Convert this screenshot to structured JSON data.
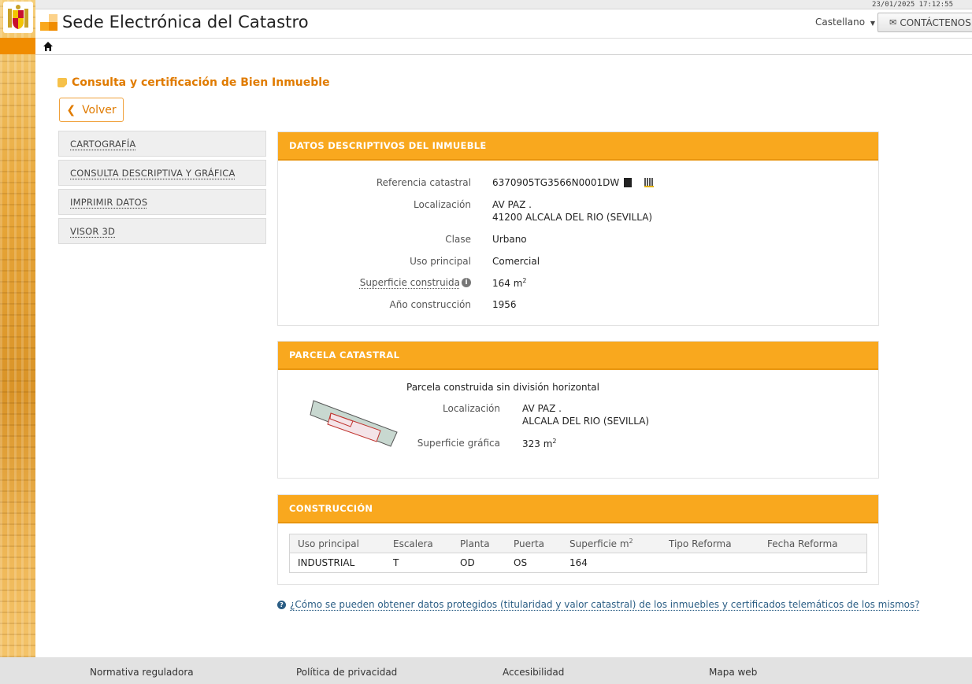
{
  "timestamp": "23/01/2025  17:12:55",
  "header": {
    "site_title": "Sede Electrónica del Catastro",
    "language": "Castellano",
    "contact_label": "CONTÁCTENOS"
  },
  "page": {
    "title": "Consulta y certificación de Bien Inmueble",
    "back_label": "Volver"
  },
  "sidemenu": {
    "items": [
      {
        "label": "CARTOGRAFÍA"
      },
      {
        "label": "CONSULTA DESCRIPTIVA Y GRÁFICA"
      },
      {
        "label": "IMPRIMIR DATOS"
      },
      {
        "label": "VISOR 3D"
      }
    ]
  },
  "datos": {
    "heading": "DATOS DESCRIPTIVOS DEL INMUEBLE",
    "ref_label": "Referencia catastral",
    "ref_value": "6370905TG3566N0001DW",
    "loc_label": "Localización",
    "loc_line1": "AV PAZ .",
    "loc_line2": "41200 ALCALA DEL RIO (SEVILLA)",
    "clase_label": "Clase",
    "clase_value": "Urbano",
    "uso_label": "Uso principal",
    "uso_value": "Comercial",
    "sup_label": "Superficie construida",
    "sup_value": "164 m",
    "sup_unit_exp": "2",
    "anio_label": "Año construcción",
    "anio_value": "1956"
  },
  "parcela": {
    "heading": "PARCELA CATASTRAL",
    "tipo": "Parcela construida sin división horizontal",
    "loc_label": "Localización",
    "loc_line1": "AV PAZ .",
    "loc_line2": "ALCALA DEL RIO (SEVILLA)",
    "sup_label": "Superficie gráfica",
    "sup_value": "323 m",
    "sup_unit_exp": "2"
  },
  "construccion": {
    "heading": "CONSTRUCCIÓN",
    "columns": [
      "Uso principal",
      "Escalera",
      "Planta",
      "Puerta",
      "Superficie m",
      "Tipo Reforma",
      "Fecha Reforma"
    ],
    "sup_col_exp": "2",
    "rows": [
      [
        "INDUSTRIAL",
        "T",
        "OD",
        "OS",
        "164",
        "",
        ""
      ]
    ]
  },
  "info_link": "¿Cómo se pueden obtener datos protegidos (titularidad y valor catastral) de los inmuebles y certificados telemáticos de los mismos?",
  "footer": {
    "links": [
      "Normativa reguladora",
      "Política de privacidad",
      "Accesibilidad",
      "Mapa web"
    ]
  },
  "colors": {
    "accent_orange": "#f9a81e",
    "title_orange": "#e07b00",
    "link_blue": "#2a5d84"
  }
}
